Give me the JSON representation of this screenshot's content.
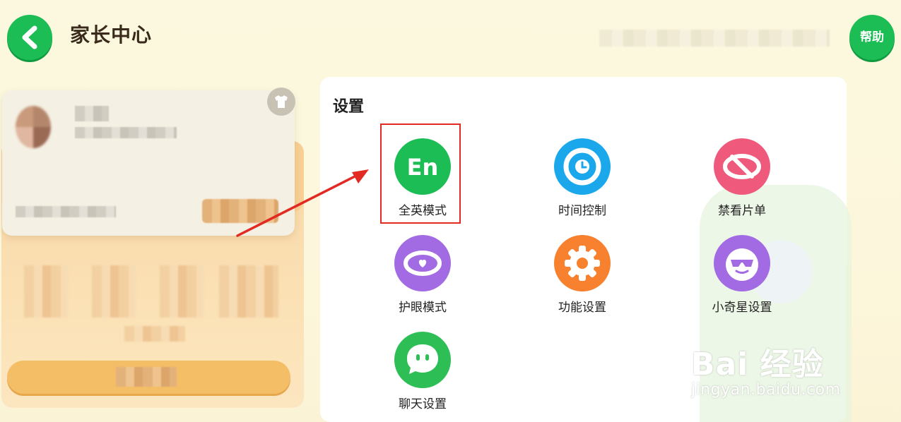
{
  "header": {
    "title": "家长中心",
    "help_label": "帮助"
  },
  "settings": {
    "title": "设置",
    "items": [
      {
        "label": "全英模式",
        "icon": "english-mode-icon",
        "color": "#1dbd56"
      },
      {
        "label": "时间控制",
        "icon": "clock-icon",
        "color": "#1aa7ec"
      },
      {
        "label": "禁看片单",
        "icon": "blocked-list-icon",
        "color": "#ef5a7c"
      },
      {
        "label": "护眼模式",
        "icon": "eye-care-icon",
        "color": "#a26ae3"
      },
      {
        "label": "功能设置",
        "icon": "gear-icon",
        "color": "#f7812e"
      },
      {
        "label": "小奇星设置",
        "icon": "star-face-icon",
        "color": "#a26ae3"
      },
      {
        "label": "聊天设置",
        "icon": "chat-icon",
        "color": "#2dbf55"
      }
    ]
  },
  "watermark": {
    "brand": "Bai 经验",
    "url": "jingyan.baidu.com"
  },
  "colors": {
    "accent_green": "#1dbd56",
    "highlight_red": "#e22a23",
    "card_orange": "#f4be67"
  }
}
